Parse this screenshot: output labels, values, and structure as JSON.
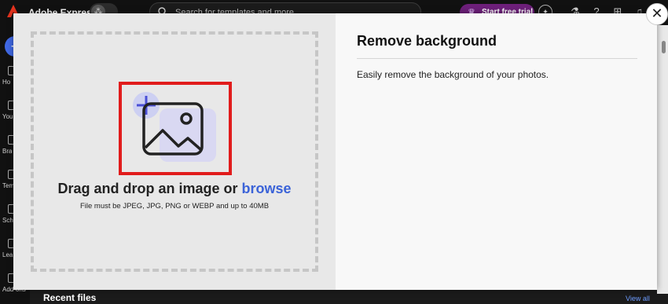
{
  "topbar": {
    "app_title": "Adobe Express",
    "search_placeholder": "Search for templates and more",
    "trial_label": "Start free trial"
  },
  "sidebar": {
    "items": [
      {
        "label": "Ho",
        "icon": "home-icon"
      },
      {
        "label": "Your",
        "icon": "folder-icon"
      },
      {
        "label": "Bra",
        "icon": "brand-icon"
      },
      {
        "label": "Temp",
        "icon": "templates-icon"
      },
      {
        "label": "Sche",
        "icon": "calendar-icon"
      },
      {
        "label": "Lea",
        "icon": "learn-icon"
      },
      {
        "label": "Add-ons",
        "icon": "add-ons-icon"
      }
    ]
  },
  "modal": {
    "drop_title_prefix": "Drag and drop an image or ",
    "drop_title_link": "browse",
    "drop_hint": "File must be JPEG, JPG, PNG or WEBP and up to 40MB",
    "title": "Remove background",
    "description": "Easily remove the background of your photos."
  },
  "main": {
    "recent_files": "Recent files",
    "view_all": "View all"
  },
  "colors": {
    "accent": "#3b63d8",
    "highlight_box": "#e11c1c",
    "trial_button": "#6d1f7a"
  }
}
